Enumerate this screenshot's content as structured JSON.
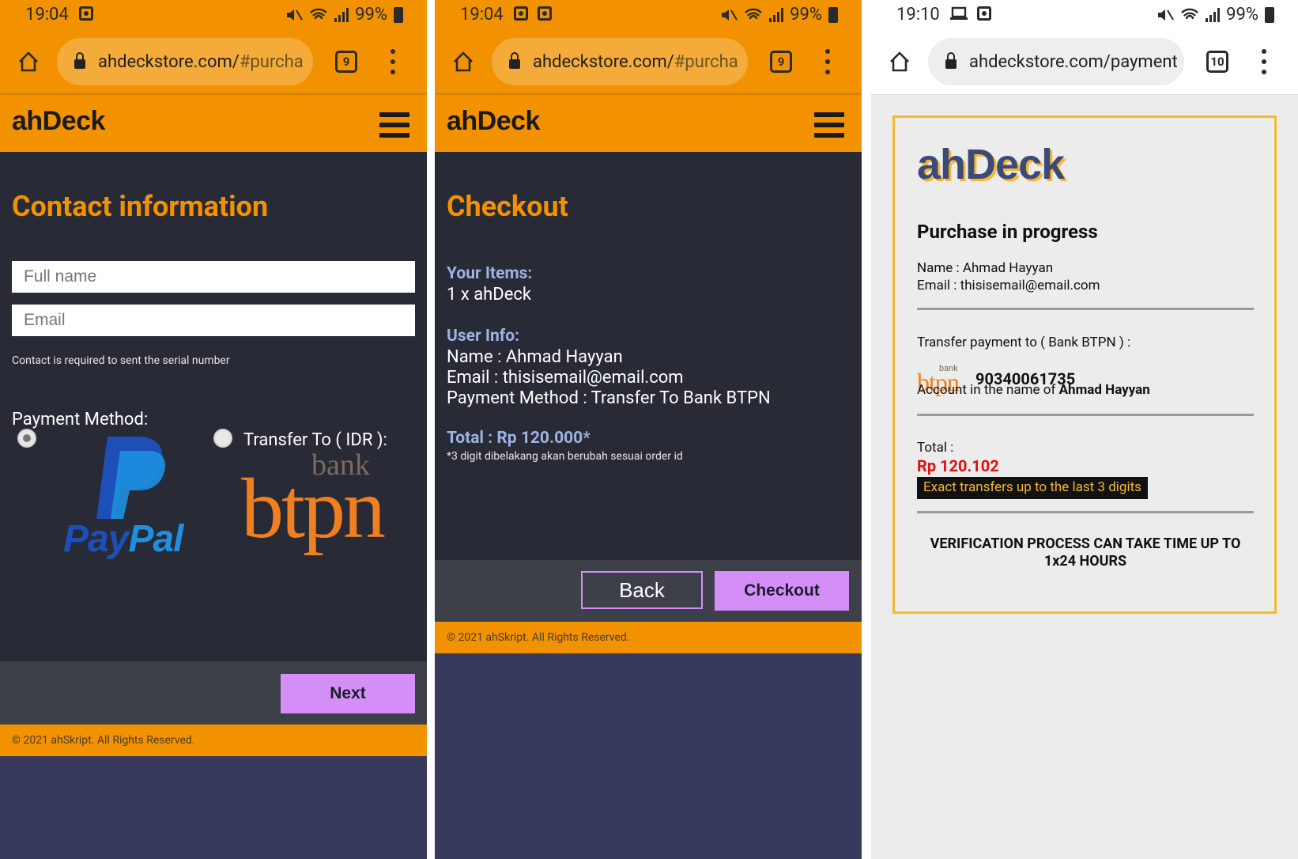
{
  "panel1": {
    "status": {
      "time": "19:04",
      "battery": "99%"
    },
    "browser": {
      "url_domain": "ahdeckstore.com/",
      "url_path": "#purcha",
      "tabs": "9"
    },
    "logo": "ahDeck",
    "title": "Contact information",
    "fullname_placeholder": "Full name",
    "email_placeholder": "Email",
    "hint": "Contact is required to sent the serial number",
    "payment_label": "Payment Method:",
    "transfer_label": "Transfer To ( IDR ):",
    "paypal_text_a": "Pay",
    "paypal_text_b": "Pal",
    "bank_word": "bank",
    "btpn_word": "btpn",
    "next_label": "Next",
    "copyright": "© 2021 ahSkript. All Rights Reserved."
  },
  "panel2": {
    "status": {
      "time": "19:04",
      "battery": "99%"
    },
    "browser": {
      "url_domain": "ahdeckstore.com/",
      "url_path": "#purcha",
      "tabs": "9"
    },
    "logo": "ahDeck",
    "title": "Checkout",
    "items_head": "Your Items:",
    "items_value": "1 x ahDeck",
    "user_head": "User Info:",
    "user_name": "Name : Ahmad Hayyan",
    "user_email": "Email : thisisemail@email.com",
    "user_method": "Payment Method : Transfer To Bank BTPN",
    "total": "Total : Rp 120.000*",
    "note": "*3 digit dibelakang akan berubah sesuai order id",
    "back_label": "Back",
    "checkout_label": "Checkout",
    "copyright": "© 2021 ahSkript. All Rights Reserved."
  },
  "panel3": {
    "status": {
      "time": "19:10",
      "battery": "99%"
    },
    "browser": {
      "url_domain": "ahdeckstore.com/",
      "url_path": "payment",
      "tabs": "10"
    },
    "logo": "ahDeck",
    "title": "Purchase in progress",
    "name_line": "Name : Ahmad Hayyan",
    "email_line": "Email : thisisemail@email.com",
    "transfer_line": "Transfer payment to ( Bank BTPN ) :",
    "bank_word": "bank",
    "btpn_word": "btpn",
    "account_number": "90340061735",
    "account_name_prefix": "Account in the name of ",
    "account_name": "Ahmad Hayyan",
    "total_label": "Total :",
    "total_amount": "Rp 120.102",
    "exact_note": "Exact transfers up to the last 3 digits",
    "verify_note": "VERIFICATION PROCESS CAN TAKE TIME UP TO 1x24 HOURS"
  },
  "colors": {
    "orange": "#f39200",
    "dark": "#282a36",
    "purple": "#d48ff7",
    "navy": "#373a5a",
    "red": "#e01010",
    "btpn": "#f07f1f"
  },
  "icons": [
    "home-icon",
    "lock-icon",
    "tab-count-icon",
    "kebab-menu-icon",
    "hamburger-icon",
    "mute-icon",
    "wifi-icon",
    "signal-icon",
    "battery-icon",
    "radio-icon"
  ]
}
